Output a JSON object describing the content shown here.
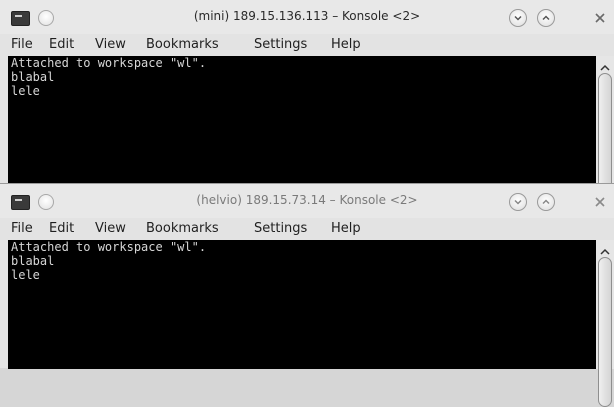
{
  "windows": [
    {
      "title": "(mini) 189.15.136.113 – Konsole <2>",
      "menu": [
        "File",
        "Edit",
        "View",
        "Bookmarks",
        "Settings",
        "Help"
      ],
      "terminal_lines": [
        "Attached to workspace \"wl\".",
        "blabal",
        "lele"
      ],
      "state": "active"
    },
    {
      "title": "(helvio) 189.15.73.14 – Konsole <2>",
      "menu": [
        "File",
        "Edit",
        "View",
        "Bookmarks",
        "Settings",
        "Help"
      ],
      "terminal_lines": [
        "Attached to workspace \"wl\".",
        "blabal",
        "lele"
      ],
      "state": "inactive"
    }
  ],
  "icons": {
    "app": "konsole-app-icon",
    "sticky": "sticky-button-icon",
    "minimize": "minimize-icon",
    "maximize": "maximize-icon",
    "close": "close-icon",
    "scroll_up": "scroll-up-arrow-icon"
  },
  "colors": {
    "terminal_bg": "#000000",
    "terminal_fg": "#d6d6d6",
    "window_chrome": "#e3e3e3"
  }
}
